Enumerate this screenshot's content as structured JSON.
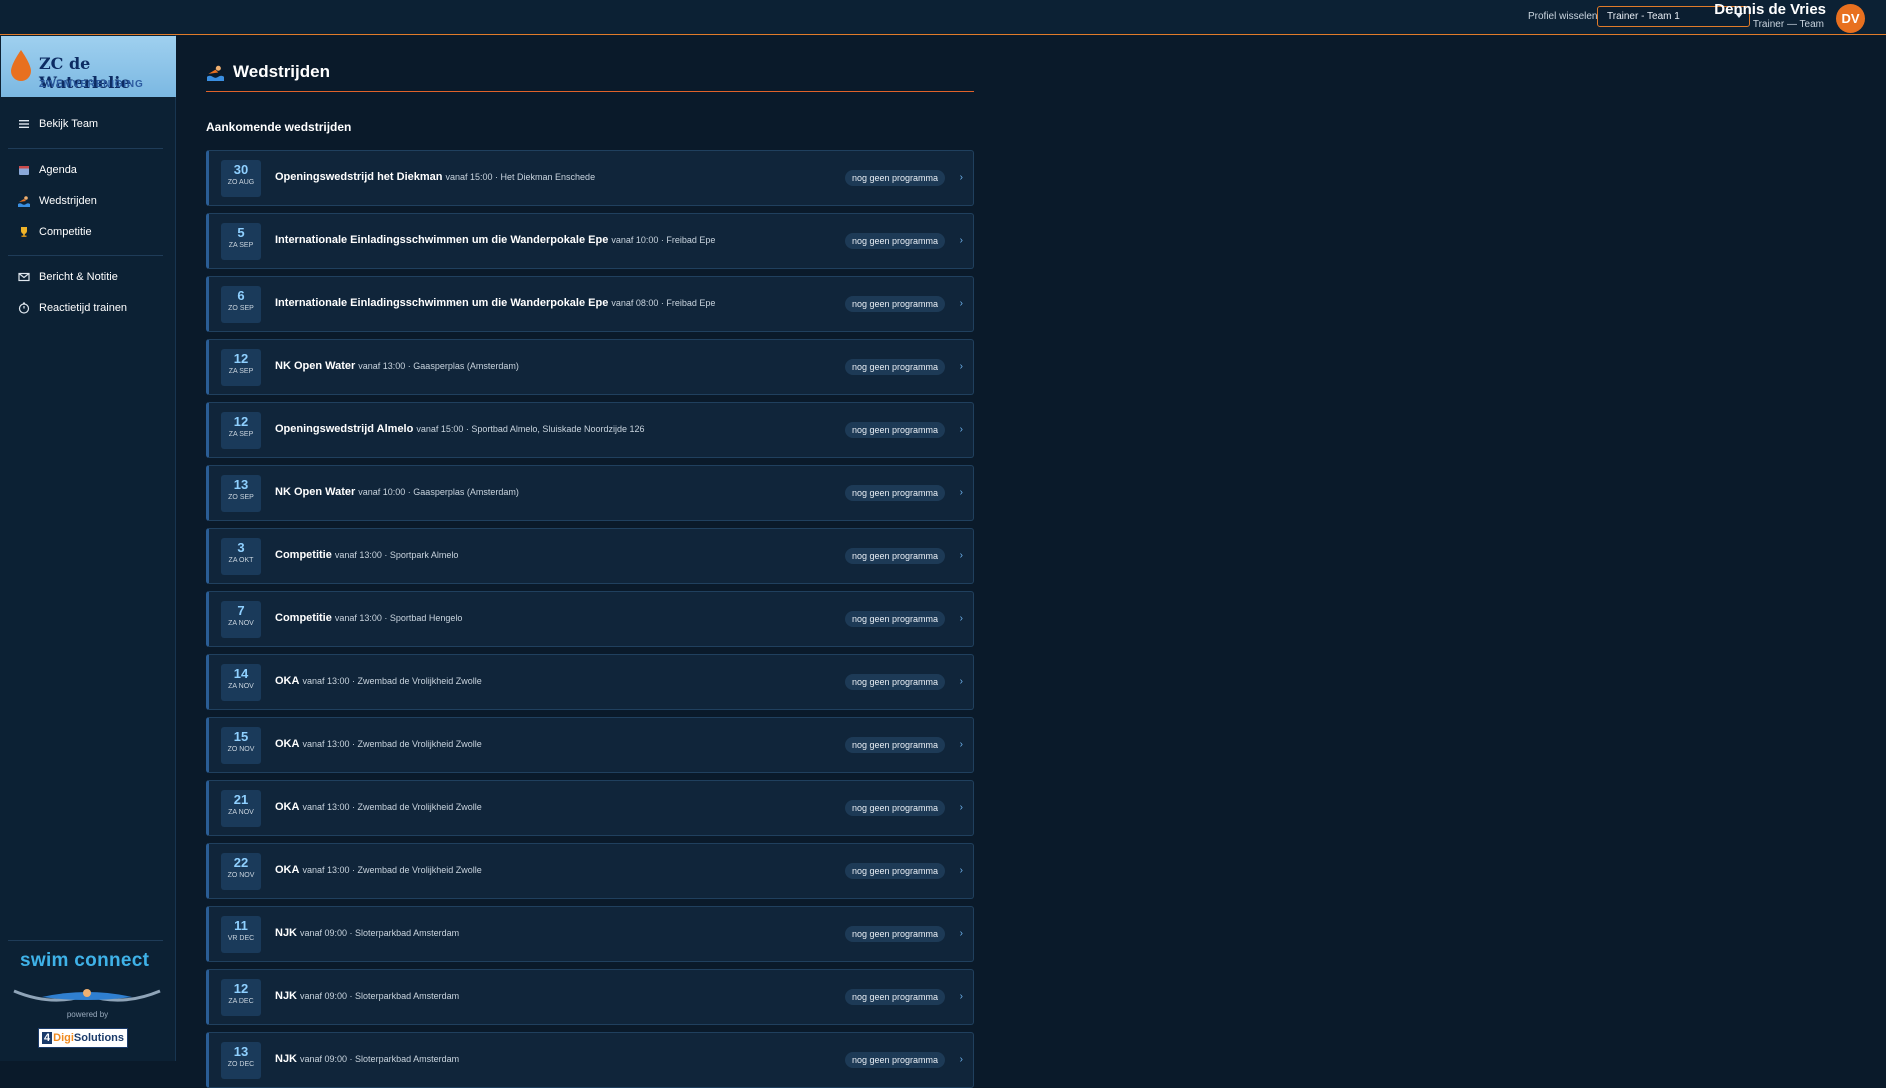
{
  "topbar": {
    "profile_label": "Profiel wisselen:",
    "profile_value": "Trainer - Team 1",
    "user_name": "Dennis de Vries",
    "user_role": "Trainer — Team",
    "avatar_initials": "DV",
    "accent_color": "#e07b2a"
  },
  "brand": {
    "name": "ZC de Waterlelie",
    "subtitle": "ZWEMVERENIGING"
  },
  "sidebar": {
    "items": [
      {
        "label": "Bekijk Team",
        "icon": "menu-icon"
      },
      {
        "label": "Agenda",
        "icon": "calendar-icon"
      },
      {
        "label": "Wedstrijden",
        "icon": "swimmer-icon"
      },
      {
        "label": "Competitie",
        "icon": "trophy-icon"
      },
      {
        "label": "Bericht & Notitie",
        "icon": "envelope-icon"
      },
      {
        "label": "Reactietijd trainen",
        "icon": "stopwatch-icon"
      }
    ],
    "footer": {
      "swim_connect": "swim connect",
      "powered_by": "powered by",
      "digi_prefix": "4",
      "digi_mid": "Digi",
      "digi_suffix": "Solutions"
    }
  },
  "main": {
    "page_title": "Wedstrijden",
    "section_title": "Aankomende wedstrijden",
    "status_label": "nog geen programma",
    "events": [
      {
        "day": "30",
        "month": "ZO AUG",
        "name": "Openingswedstrijd het Diekman",
        "meta": "vanaf 15:00 · Het Diekman Enschede"
      },
      {
        "day": "5",
        "month": "ZA SEP",
        "name": "Internationale Einladingsschwimmen um die Wanderpokale Epe",
        "meta": "vanaf 10:00 · Freibad Epe"
      },
      {
        "day": "6",
        "month": "ZO SEP",
        "name": "Internationale Einladingsschwimmen um die Wanderpokale Epe",
        "meta": "vanaf 08:00 · Freibad Epe"
      },
      {
        "day": "12",
        "month": "ZA SEP",
        "name": "NK Open Water",
        "meta": "vanaf 13:00 · Gaasperplas (Amsterdam)"
      },
      {
        "day": "12",
        "month": "ZA SEP",
        "name": "Openingswedstrijd Almelo",
        "meta": "vanaf 15:00 · Sportbad Almelo, Sluiskade Noordzijde 126"
      },
      {
        "day": "13",
        "month": "ZO SEP",
        "name": "NK Open Water",
        "meta": "vanaf 10:00 · Gaasperplas (Amsterdam)"
      },
      {
        "day": "3",
        "month": "ZA OKT",
        "name": "Competitie",
        "meta": "vanaf 13:00 · Sportpark Almelo"
      },
      {
        "day": "7",
        "month": "ZA NOV",
        "name": "Competitie",
        "meta": "vanaf 13:00 · Sportbad Hengelo"
      },
      {
        "day": "14",
        "month": "ZA NOV",
        "name": "OKA",
        "meta": "vanaf 13:00 · Zwembad de Vrolijkheid Zwolle"
      },
      {
        "day": "15",
        "month": "ZO NOV",
        "name": "OKA",
        "meta": "vanaf 13:00 · Zwembad de Vrolijkheid Zwolle"
      },
      {
        "day": "21",
        "month": "ZA NOV",
        "name": "OKA",
        "meta": "vanaf 13:00 · Zwembad de Vrolijkheid Zwolle"
      },
      {
        "day": "22",
        "month": "ZO NOV",
        "name": "OKA",
        "meta": "vanaf 13:00 · Zwembad de Vrolijkheid Zwolle"
      },
      {
        "day": "11",
        "month": "VR DEC",
        "name": "NJK",
        "meta": "vanaf 09:00 · Sloterparkbad Amsterdam"
      },
      {
        "day": "12",
        "month": "ZA DEC",
        "name": "NJK",
        "meta": "vanaf 09:00 · Sloterparkbad Amsterdam"
      },
      {
        "day": "13",
        "month": "ZO DEC",
        "name": "NJK",
        "meta": "vanaf 09:00 · Sloterparkbad Amsterdam"
      }
    ]
  }
}
